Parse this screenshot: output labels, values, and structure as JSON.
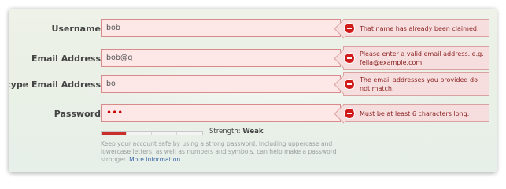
{
  "form": {
    "username": {
      "label": "Username",
      "value": "bob",
      "error": "That name has already been claimed."
    },
    "email": {
      "label": "Email Address",
      "value": "bob@g",
      "error": "Please enter a valid email address. e.g. fella@example.com"
    },
    "retype_email": {
      "label": "Retype Email Address",
      "value": "bo",
      "error": "The email addresses you provided do not match."
    },
    "password": {
      "label": "Password",
      "value": "•••",
      "error": "Must be at least 6 characters long."
    }
  },
  "strength": {
    "label": "Strength:",
    "value": "Weak",
    "level_fraction": 0.25,
    "color": "#c9302c"
  },
  "help": {
    "text": "Keep your account safe by using a strong password. Including uppercase and lowercase letters, as well as numbers and symbols, can help make a password stronger.",
    "link": "More information"
  },
  "colors": {
    "error_background": "#f7dede",
    "error_icon": "#d11a1a",
    "input_error_background": "#fde7e7"
  }
}
